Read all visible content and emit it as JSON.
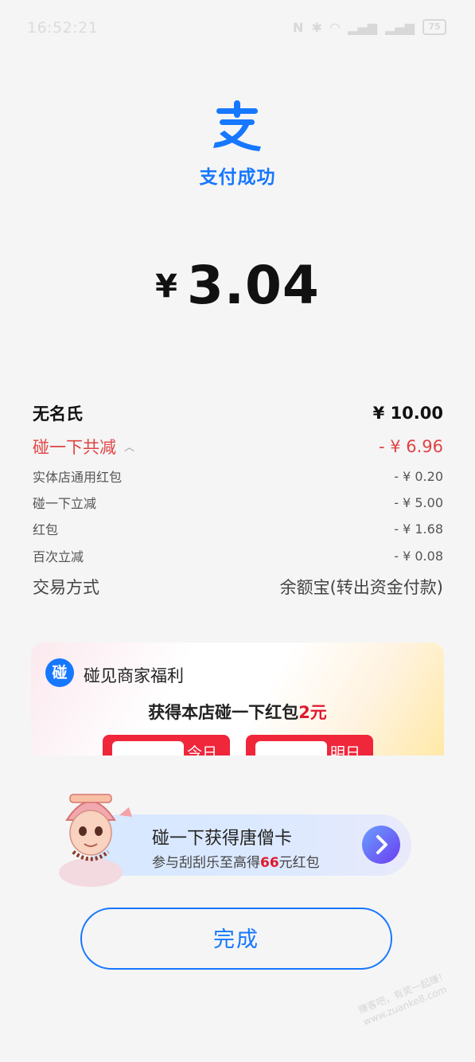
{
  "status_bar": {
    "time": "16:52:21",
    "battery": "75"
  },
  "header": {
    "title": "支付成功"
  },
  "amount": {
    "currency": "¥",
    "value": "3.04"
  },
  "details": {
    "payee": {
      "label": "无名氏",
      "value": "¥ 10.00"
    },
    "discount_total": {
      "label": "碰一下共减",
      "value": "- ¥ 6.96"
    },
    "discounts": [
      {
        "label": "实体店通用红包",
        "value": "- ¥ 0.20"
      },
      {
        "label": "碰一下立减",
        "value": "- ¥ 5.00"
      },
      {
        "label": "红包",
        "value": "- ¥ 1.68"
      },
      {
        "label": "百次立减",
        "value": "- ¥ 0.08"
      }
    ],
    "method": {
      "label": "交易方式",
      "value": "余额宝(转出资金付款)"
    }
  },
  "welfare": {
    "icon_char": "碰",
    "title": "碰见商家福利",
    "gain_text": "获得本店碰一下红包",
    "gain_amount": "2元",
    "coupons": [
      {
        "label": "今日"
      },
      {
        "label": "明日"
      }
    ]
  },
  "promo": {
    "title": "碰一下获得唐僧卡",
    "subtitle_before": "参与刮刮乐至高得",
    "subtitle_amount": "66",
    "subtitle_after": "元红包"
  },
  "done_button": {
    "label": "完成"
  },
  "watermark": {
    "line1": "赚客吧，有奖一起赚！",
    "line2": "www.zuanke8.com"
  },
  "colors": {
    "accent": "#1677ff",
    "discount_red": "#e04343",
    "welfare_red": "#e0182d"
  }
}
